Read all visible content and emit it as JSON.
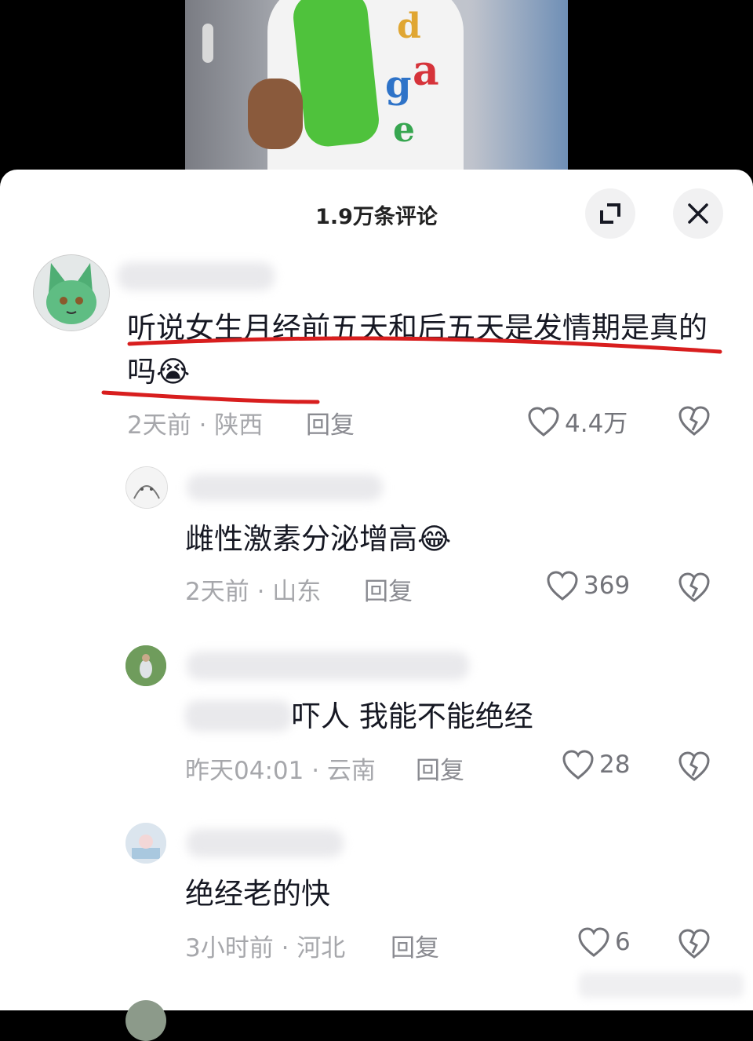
{
  "header": {
    "title": "1.9万条评论"
  },
  "comments": [
    {
      "text": "听说女生月经前五天和后五天是发情期是真的吗",
      "emoji": "😭",
      "meta": "2天前 · 陕西",
      "reply_label": "回复",
      "likes": "4.4万"
    },
    {
      "text": "雌性激素分泌增高",
      "emoji": "😂",
      "meta": "2天前 · 山东",
      "reply_label": "回复",
      "likes": "369"
    },
    {
      "text": "吓人 我能不能绝经",
      "meta": "昨天04:01 · 云南",
      "reply_label": "回复",
      "likes": "28"
    },
    {
      "text": "绝经老的快",
      "meta": "3小时前 · 河北",
      "reply_label": "回复",
      "likes": "6"
    }
  ],
  "colors": {
    "annotation_red": "#d81e1e",
    "text": "#161823",
    "meta": "#a6a7ab"
  }
}
